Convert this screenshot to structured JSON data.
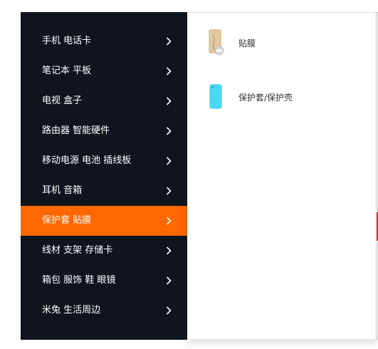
{
  "menu": {
    "items": [
      {
        "label": "手机 电话卡"
      },
      {
        "label": "笔记本 平板"
      },
      {
        "label": "电视 盒子"
      },
      {
        "label": "路由器 智能硬件"
      },
      {
        "label": "移动电源 电池 插线板"
      },
      {
        "label": "耳机 音箱"
      },
      {
        "label": "保护套 贴膜"
      },
      {
        "label": "线材 支架 存储卡"
      },
      {
        "label": "箱包 服饰 鞋 眼镜"
      },
      {
        "label": "米兔 生活周边"
      }
    ],
    "active_index": 6,
    "colors": {
      "background": "#10141c",
      "active": "#ff6700",
      "text": "#ffffff"
    }
  },
  "flyout": {
    "products": [
      {
        "label": "贴膜",
        "icon": "screen-film-icon"
      },
      {
        "label": "保护套/保护壳",
        "icon": "phone-case-icon"
      }
    ]
  }
}
